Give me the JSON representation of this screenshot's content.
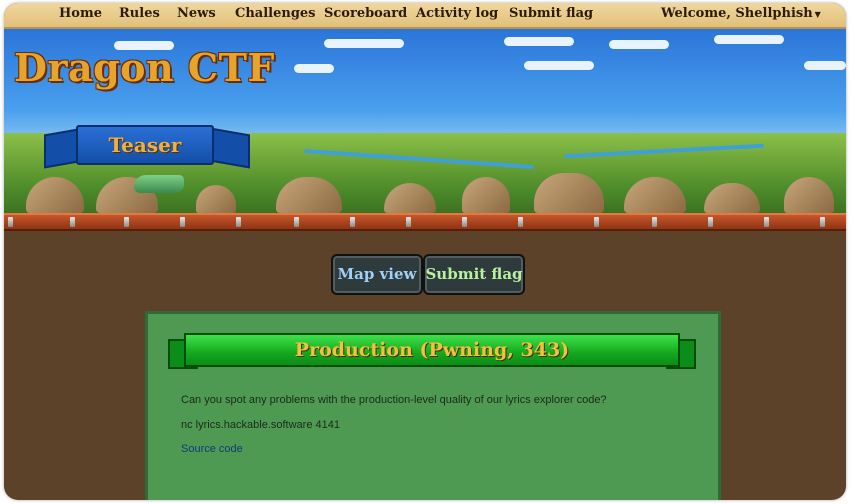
{
  "nav": {
    "home": "Home",
    "rules": "Rules",
    "news": "News",
    "challenges": "Challenges",
    "scoreboard": "Scoreboard",
    "activity_log": "Activity log",
    "submit_flag": "Submit flag",
    "welcome": "Welcome, Shellphish",
    "welcome_caret_icon": "chevron-down-icon"
  },
  "logo": {
    "title": "Dragon CTF",
    "subtitle": "Teaser"
  },
  "actions": {
    "map_view": "Map view",
    "submit_flag": "Submit flag"
  },
  "challenge": {
    "title": "Production (Pwning, 343)",
    "description": "Can you spot any problems with the production-level quality of our lyrics explorer code?",
    "connection": "nc lyrics.hackable.software 4141",
    "source_link": "Source code"
  },
  "colors": {
    "nav_bg": "#e8c98a",
    "page_bg": "#5b4229",
    "card_bg": "#4f9a52",
    "title_text": "#f2c23a",
    "map_view_text": "#9fd0f5",
    "submit_text": "#b8f0a0"
  }
}
